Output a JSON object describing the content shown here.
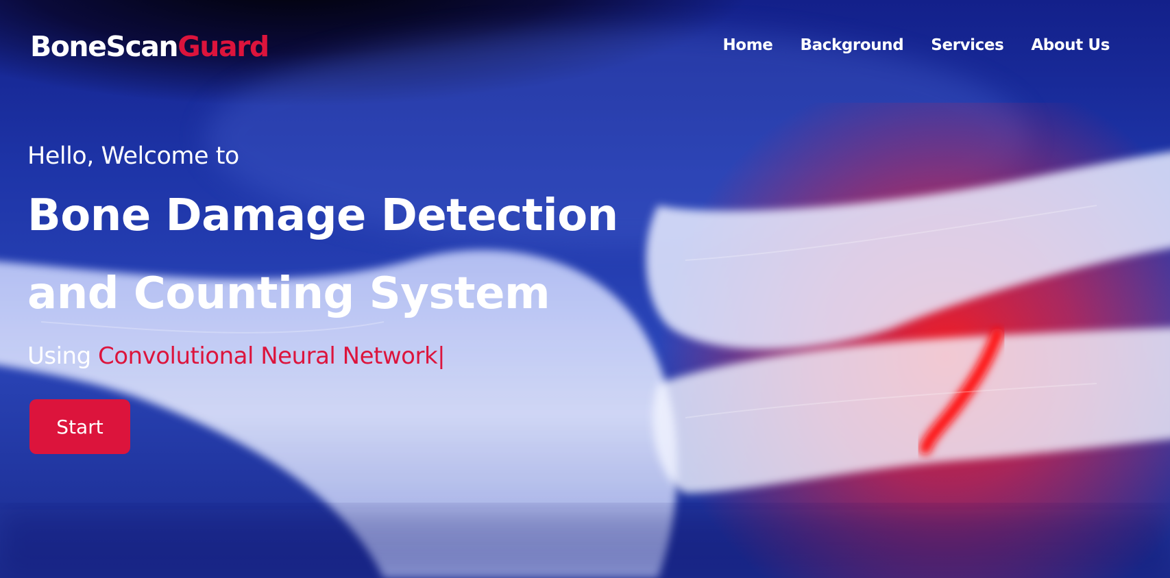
{
  "brand": {
    "name_part1": "BoneScan",
    "name_part2": "Guard"
  },
  "nav": [
    {
      "label": "Home"
    },
    {
      "label": "Background"
    },
    {
      "label": "Services"
    },
    {
      "label": "About Us"
    }
  ],
  "hero": {
    "greeting": "Hello, Welcome to",
    "title_line1": "Bone Damage Detection",
    "title_line2": "and Counting System",
    "subtitle_prefix": "Using ",
    "subtitle_highlight": "Convolutional Neural Network|",
    "start_label": "Start"
  },
  "colors": {
    "accent": "#dc143c",
    "background": "#1e35a8"
  },
  "background_image": "x-ray forearm with fracture"
}
